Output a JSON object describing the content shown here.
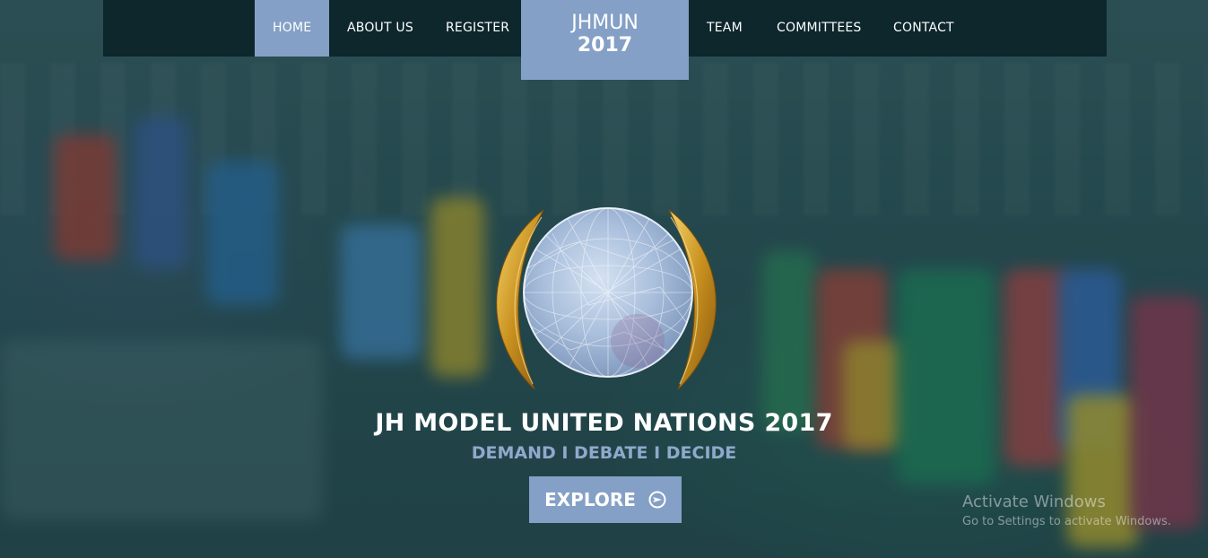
{
  "nav": {
    "items": [
      {
        "label": "HOME",
        "active": true
      },
      {
        "label": "ABOUT US",
        "active": false
      },
      {
        "label": "REGISTER",
        "active": false
      },
      {
        "label": "TEAM",
        "active": false
      },
      {
        "label": "COMMITTEES",
        "active": false
      },
      {
        "label": "CONTACT",
        "active": false
      }
    ],
    "brand": {
      "name": "JHMUN",
      "year": "2017"
    }
  },
  "hero": {
    "title": "JH MODEL UNITED NATIONS 2017",
    "tagline": "DEMAND I DEBATE I DECIDE",
    "explore_label": "EXPLORE",
    "emblem_icon": "globe-laurel-emblem-icon"
  },
  "watermark": {
    "title": "Activate Windows",
    "subtitle": "Go to Settings to activate Windows."
  },
  "colors": {
    "accent": "#84a0c6",
    "navbar": "#0d272c",
    "tagline": "#8fa9cc",
    "overlay": "#183e42"
  }
}
